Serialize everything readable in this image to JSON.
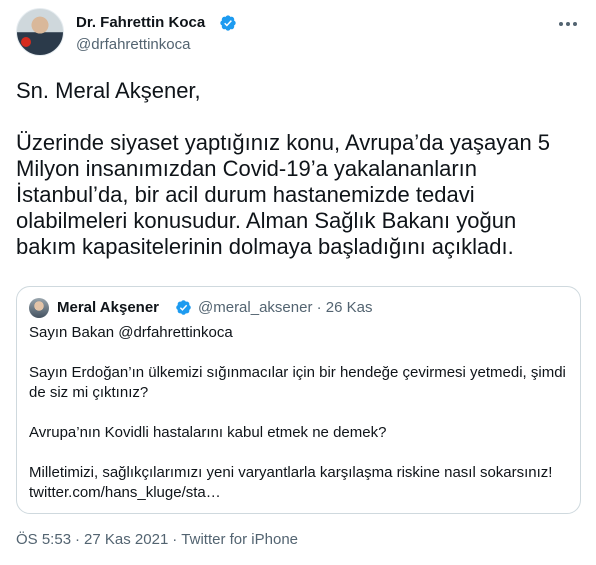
{
  "author": {
    "display_name": "Dr. Fahrettin Koca",
    "handle": "@drfahrettinkoca",
    "verified_icon": "verified-badge-icon"
  },
  "menu_icon": "more-horizontal-icon",
  "tweet": {
    "text": "Sn. Meral Akşener,\n\nÜzerinde siyaset yaptığınız konu, Avrupa’da yaşayan 5 Milyon insanımızdan Covid-19’a yakalananların İstanbul’da, bir acil durum hastanemizde tedavi olabilmeleri konusudur. Alman Sağlık Bakanı yoğun bakım kapasitelerinin dolmaya başladığını açıkladı."
  },
  "quoted_tweet": {
    "display_name": "Meral Akşener",
    "meta": "@meral_aksener · 26 Kas",
    "text": "Sayın Bakan @drfahrettinkoca\n\nSayın Erdoğan’ın ülkemizi sığınmacılar için bir hendeğe çevirmesi yetmedi, şimdi de siz mi çıktınız?\n\nAvrupa’nın Kovidli hastalarını kabul etmek ne demek?\n\nMilletimizi, sağlıkçılarımızı yeni varyantlarla karşılaşma riskine nasıl sokarsınız!\ntwitter.com/hans_kluge/sta…"
  },
  "footer": {
    "time": "ÖS 5:53",
    "separator": "·",
    "date": "27 Kas 2021",
    "source": "Twitter for iPhone"
  },
  "colors": {
    "verified": "#1d9bf0",
    "secondary_text": "#536471",
    "border": "#cfd9de",
    "text": "#0f1419"
  }
}
